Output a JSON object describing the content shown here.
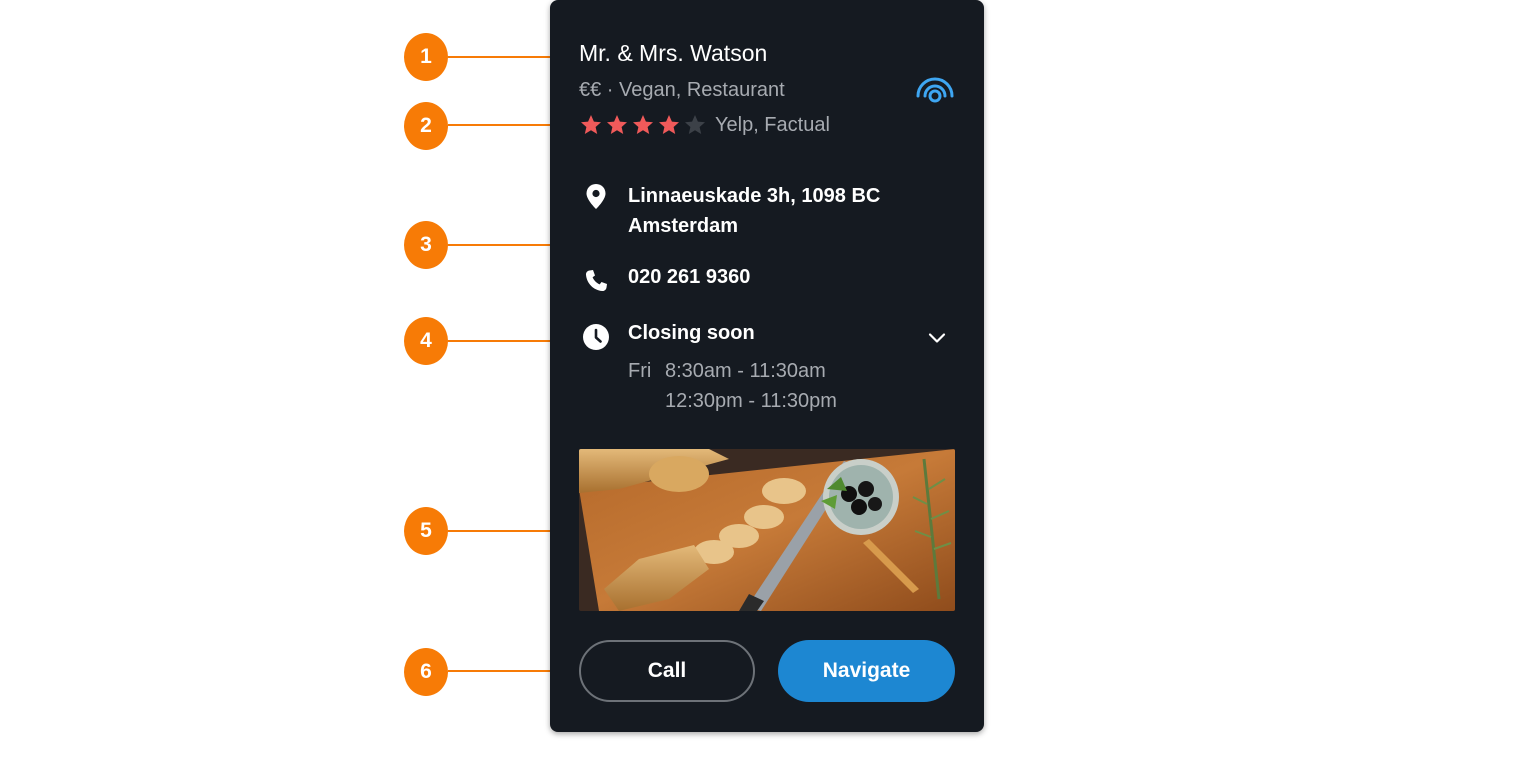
{
  "markers": [
    "1",
    "2",
    "3",
    "4",
    "5",
    "6"
  ],
  "place": {
    "name": "Mr. & Mrs. Watson",
    "meta": "€€ · Vegan, Restaurant",
    "rating": 4,
    "rating_max": 5,
    "rating_source": "Yelp, Factual",
    "address_line1": "Linnaeuskade 3h, 1098 BC",
    "address_line2": "Amsterdam",
    "phone": "020 261 9360",
    "hours_status": "Closing soon",
    "hours_day": "Fri",
    "hours_range1": "8:30am - 11:30am",
    "hours_range2": "12:30pm - 11:30pm",
    "photo": "bread-knife-olives-board"
  },
  "actions": {
    "call_label": "Call",
    "navigate_label": "Navigate"
  },
  "icons": {
    "beacon": "live-signal-icon",
    "location": "location-pin-icon",
    "phone": "phone-icon",
    "clock": "clock-icon",
    "expand": "chevron-down-icon"
  },
  "colors": {
    "card_bg": "#151a21",
    "accent_marker": "#f77b06",
    "star_filled": "#f05a5a",
    "star_empty": "#3c4148",
    "primary_button": "#1d87d2",
    "beacon": "#3ea6f2"
  }
}
